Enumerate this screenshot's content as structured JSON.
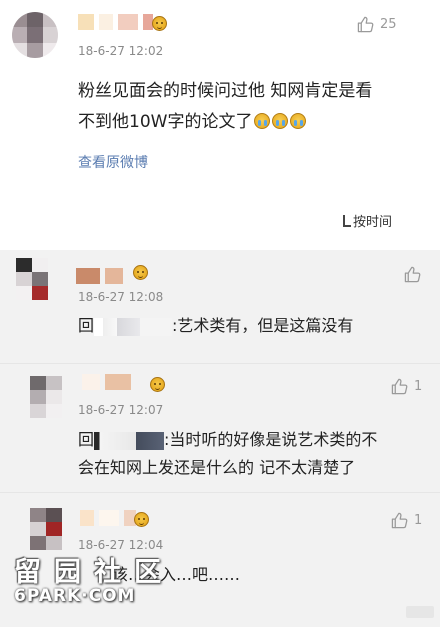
{
  "main_comment": {
    "timestamp": "18-6-27 12:02",
    "like_count": "25",
    "text_line1": "粉丝见面会的时候问过他 知网肯定是看",
    "text_line2": "不到他10W字的论文了",
    "emojis": [
      "crying-emoji",
      "crying-emoji",
      "crying-emoji"
    ],
    "view_original": "查看原微博",
    "sort_label": "按时间"
  },
  "replies": [
    {
      "timestamp": "18-6-27 12:08",
      "reply_prefix": "回",
      "text": ":艺术类有，但是这篇没有",
      "like_count": ""
    },
    {
      "timestamp": "18-6-27 12:07",
      "reply_prefix": "回",
      "text_line1": ":当时听的好像是说艺术类的不",
      "text_line2": "会在知网上发还是什么的 记不太清楚了",
      "like_count": "1"
    },
    {
      "timestamp": "18-6-27 12:04",
      "text": "该…会入…吧……",
      "like_count": "1"
    }
  ],
  "watermark": {
    "cn": "留园社区",
    "en": "6PARK·COM"
  },
  "colors": {
    "link": "#5b7db1",
    "timestamp": "#8a8a8a",
    "reply_background": "#f2f2f2"
  }
}
